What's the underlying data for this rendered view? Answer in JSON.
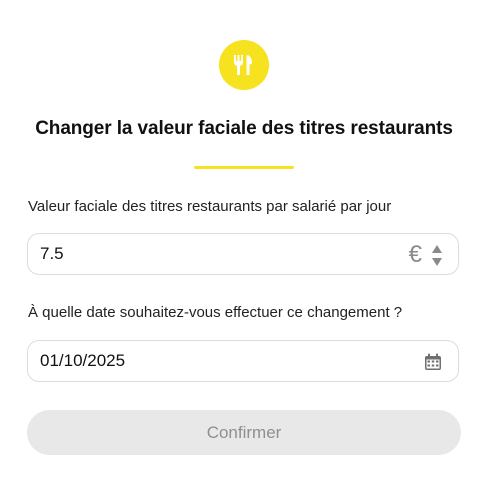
{
  "dialog": {
    "title": "Changer la valeur faciale des titres restaurants",
    "accent_color": "#f7e21f"
  },
  "amount_field": {
    "label": "Valeur faciale des titres restaurants par salarié par jour",
    "value": "7.5",
    "currency": "€",
    "spinner_icon": "up-down-arrows-icon"
  },
  "date_field": {
    "label": "À quelle date souhaitez-vous effectuer ce changement ?",
    "value": "01/10/2025",
    "icon": "calendar-icon"
  },
  "actions": {
    "confirm_label": "Confirmer",
    "confirm_enabled": false
  }
}
